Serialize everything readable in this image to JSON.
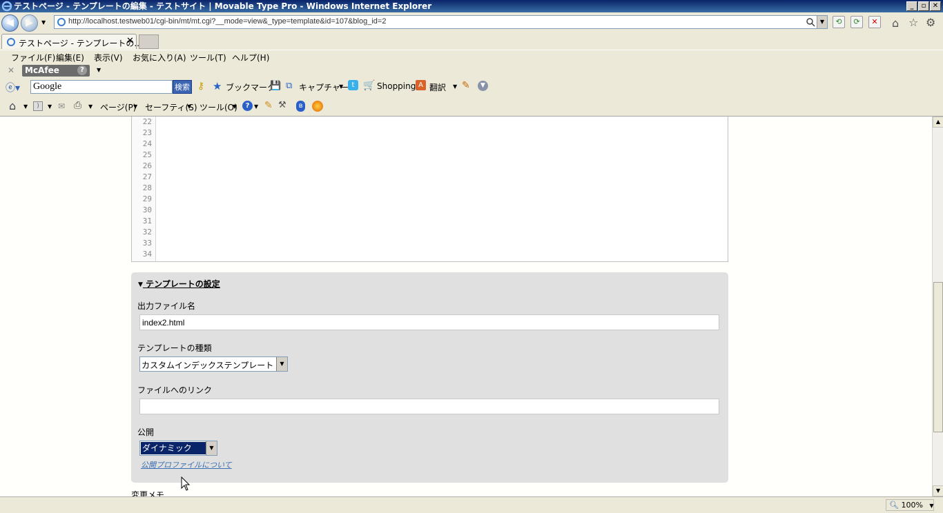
{
  "window": {
    "title": "テストページ - テンプレートの編集 - テストサイト | Movable Type Pro - Windows Internet Explorer",
    "controls": [
      "_",
      "▫",
      "✕"
    ]
  },
  "address": {
    "url": "http://localhost.testweb01/cgi-bin/mt/mt.cgi?__mode=view&_type=template&id=107&blog_id=2"
  },
  "tabs": [
    {
      "label": "テストページ - テンプレートの..."
    }
  ],
  "menu": {
    "items": [
      "ファイル(F)",
      "編集(E)",
      "表示(V)",
      "お気に入り(A)",
      "ツール(T)",
      "ヘルプ(H)"
    ]
  },
  "mcafee": {
    "label": "McAfee",
    "help": "?"
  },
  "google_toolbar": {
    "search_value": "Google",
    "search_button": "検索",
    "bookmark": "ブックマーク",
    "capture": "キャプチャー",
    "shopping": "Shopping",
    "translate": "翻訳"
  },
  "command_bar": {
    "page": "ページ(P)",
    "safety": "セーフティ(S)",
    "tools": "ツール(O)"
  },
  "editor": {
    "line_numbers": [
      "22",
      "23",
      "24",
      "25",
      "26",
      "27",
      "28",
      "29",
      "30",
      "31",
      "32",
      "33",
      "34"
    ]
  },
  "settings": {
    "heading": "テンプレートの設定",
    "output_file_label": "出力ファイル名",
    "output_file_value": "index2.html",
    "template_type_label": "テンプレートの種類",
    "template_type_value": "カスタムインデックステンプレート",
    "file_link_label": "ファイルへのリンク",
    "file_link_value": "",
    "publish_label": "公開",
    "publish_value": "ダイナミック",
    "publish_profile_link": "公開プロファイルについて"
  },
  "memo_label": "変更メモ",
  "status": {
    "zoom": "100%"
  }
}
